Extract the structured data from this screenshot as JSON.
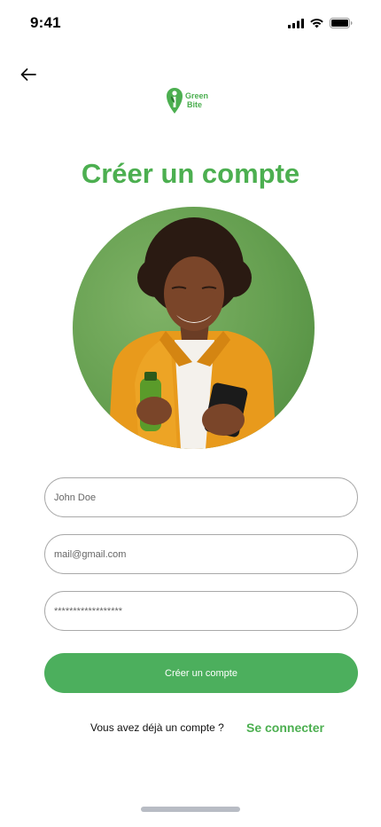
{
  "status_bar": {
    "time": "9:41"
  },
  "logo": {
    "line1": "Green",
    "line2": "Bite"
  },
  "title": "Créer un compte",
  "form": {
    "name_placeholder": "John Doe",
    "email_placeholder": "mail@gmail.com",
    "password_placeholder": "******************",
    "submit_label": "Créer un compte"
  },
  "login": {
    "prompt": "Vous avez déjà un compte ?",
    "link": "Se connecter"
  },
  "colors": {
    "accent": "#4caf50",
    "button": "#4caf5d"
  }
}
